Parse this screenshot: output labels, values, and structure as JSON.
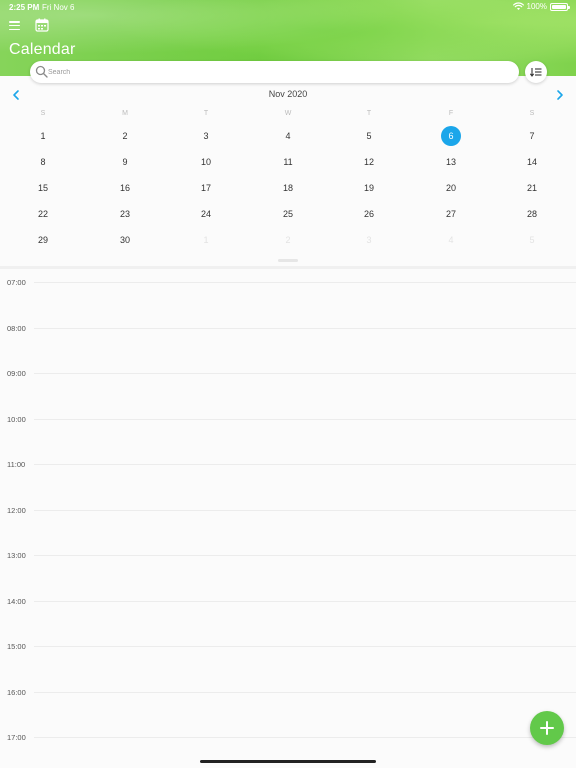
{
  "status_bar": {
    "time": "2:25 PM",
    "date": "Fri Nov 6",
    "battery": "100%"
  },
  "header": {
    "title": "Calendar"
  },
  "search": {
    "placeholder": "Search"
  },
  "calendar": {
    "month_label": "Nov 2020",
    "weekdays": [
      "S",
      "M",
      "T",
      "W",
      "T",
      "F",
      "S"
    ],
    "weeks": [
      [
        {
          "d": "1"
        },
        {
          "d": "2"
        },
        {
          "d": "3"
        },
        {
          "d": "4"
        },
        {
          "d": "5"
        },
        {
          "d": "6",
          "selected": true
        },
        {
          "d": "7"
        }
      ],
      [
        {
          "d": "8"
        },
        {
          "d": "9"
        },
        {
          "d": "10"
        },
        {
          "d": "11"
        },
        {
          "d": "12"
        },
        {
          "d": "13"
        },
        {
          "d": "14"
        }
      ],
      [
        {
          "d": "15"
        },
        {
          "d": "16"
        },
        {
          "d": "17"
        },
        {
          "d": "18"
        },
        {
          "d": "19"
        },
        {
          "d": "20"
        },
        {
          "d": "21"
        }
      ],
      [
        {
          "d": "22"
        },
        {
          "d": "23"
        },
        {
          "d": "24"
        },
        {
          "d": "25"
        },
        {
          "d": "26"
        },
        {
          "d": "27"
        },
        {
          "d": "28"
        }
      ],
      [
        {
          "d": "29"
        },
        {
          "d": "30"
        },
        {
          "d": "1",
          "other": true
        },
        {
          "d": "2",
          "other": true
        },
        {
          "d": "3",
          "other": true
        },
        {
          "d": "4",
          "other": true
        },
        {
          "d": "5",
          "other": true
        }
      ]
    ]
  },
  "timeline": {
    "hours": [
      "07:00",
      "08:00",
      "09:00",
      "10:00",
      "11:00",
      "12:00",
      "13:00",
      "14:00",
      "15:00",
      "16:00",
      "17:00"
    ]
  },
  "colors": {
    "accent_blue": "#1ba6ea",
    "fab_green": "#62c94a",
    "header_green": "#6fcb3f"
  },
  "icons": {
    "menu": "menu-icon",
    "calendar": "calendar-icon",
    "search": "search-icon",
    "sort": "sort-icon",
    "prev": "chevron-left-icon",
    "next": "chevron-right-icon",
    "add": "plus-icon"
  }
}
